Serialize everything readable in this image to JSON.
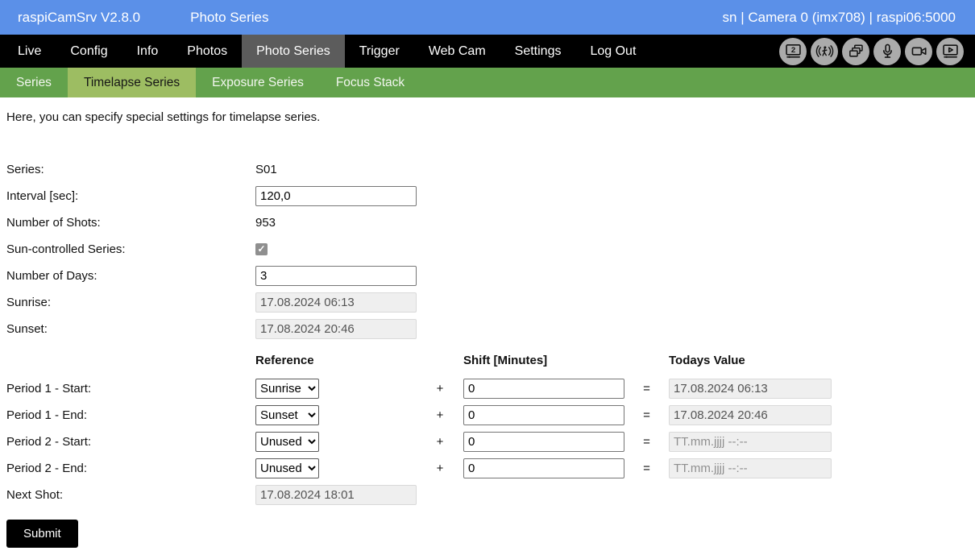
{
  "topbar": {
    "app_title": "raspiCamSrv V2.8.0",
    "page_title": "Photo Series",
    "connection_status": "sn | Camera 0 (imx708) | raspi06:5000"
  },
  "nav": {
    "items": [
      {
        "label": "Live"
      },
      {
        "label": "Config"
      },
      {
        "label": "Info"
      },
      {
        "label": "Photos"
      },
      {
        "label": "Photo Series",
        "active": true
      },
      {
        "label": "Trigger"
      },
      {
        "label": "Web Cam"
      },
      {
        "label": "Settings"
      },
      {
        "label": "Log Out"
      }
    ],
    "icons": [
      {
        "name": "display-2-icon"
      },
      {
        "name": "motion-detection-icon"
      },
      {
        "name": "photo-series-icon"
      },
      {
        "name": "microphone-icon"
      },
      {
        "name": "video-camera-icon"
      },
      {
        "name": "video-player-icon"
      }
    ]
  },
  "subnav": {
    "items": [
      {
        "label": "Series"
      },
      {
        "label": "Timelapse Series",
        "active": true
      },
      {
        "label": "Exposure Series"
      },
      {
        "label": "Focus Stack"
      }
    ]
  },
  "main": {
    "description": "Here, you can specify special settings for timelapse series.",
    "form": {
      "series_label": "Series:",
      "series_value": "S01",
      "interval_label": "Interval [sec]:",
      "interval_value": "120,0",
      "shots_label": "Number of Shots:",
      "shots_value": "953",
      "sun_label": "Sun-controlled Series:",
      "sun_checked": true,
      "checkmark": "✓",
      "days_label": "Number of Days:",
      "days_value": "3",
      "sunrise_label": "Sunrise:",
      "sunrise_value": "17.08.2024 06:13",
      "sunset_label": "Sunset:",
      "sunset_value": "17.08.2024 20:46",
      "col_reference": "Reference",
      "col_shift": "Shift [Minutes]",
      "col_todays": "Todays Value",
      "plus": "+",
      "equals": "=",
      "periods": [
        {
          "label": "Period 1 - Start:",
          "reference": "Sunrise",
          "shift": "0",
          "todays": "17.08.2024 06:13"
        },
        {
          "label": "Period 1 - End:",
          "reference": "Sunset",
          "shift": "0",
          "todays": "17.08.2024 20:46"
        },
        {
          "label": "Period 2 - Start:",
          "reference": "Unused",
          "shift": "0",
          "todays": "TT.mm.jjjj --:--"
        },
        {
          "label": "Period 2 - End:",
          "reference": "Unused",
          "shift": "0",
          "todays": "TT.mm.jjjj --:--"
        }
      ],
      "next_shot_label": "Next Shot:",
      "next_shot_value": "17.08.2024 18:01",
      "submit_label": "Submit"
    }
  },
  "colors": {
    "topbar_bg": "#5b90e8",
    "nav_bg": "#000000",
    "nav_active_bg": "#5c5c5c",
    "subnav_bg": "#63a24c",
    "subnav_active_bg": "#9dbd62",
    "icon_circle_bg": "#ababab",
    "disabled_input_bg": "#efefef",
    "submit_bg": "#000000"
  }
}
